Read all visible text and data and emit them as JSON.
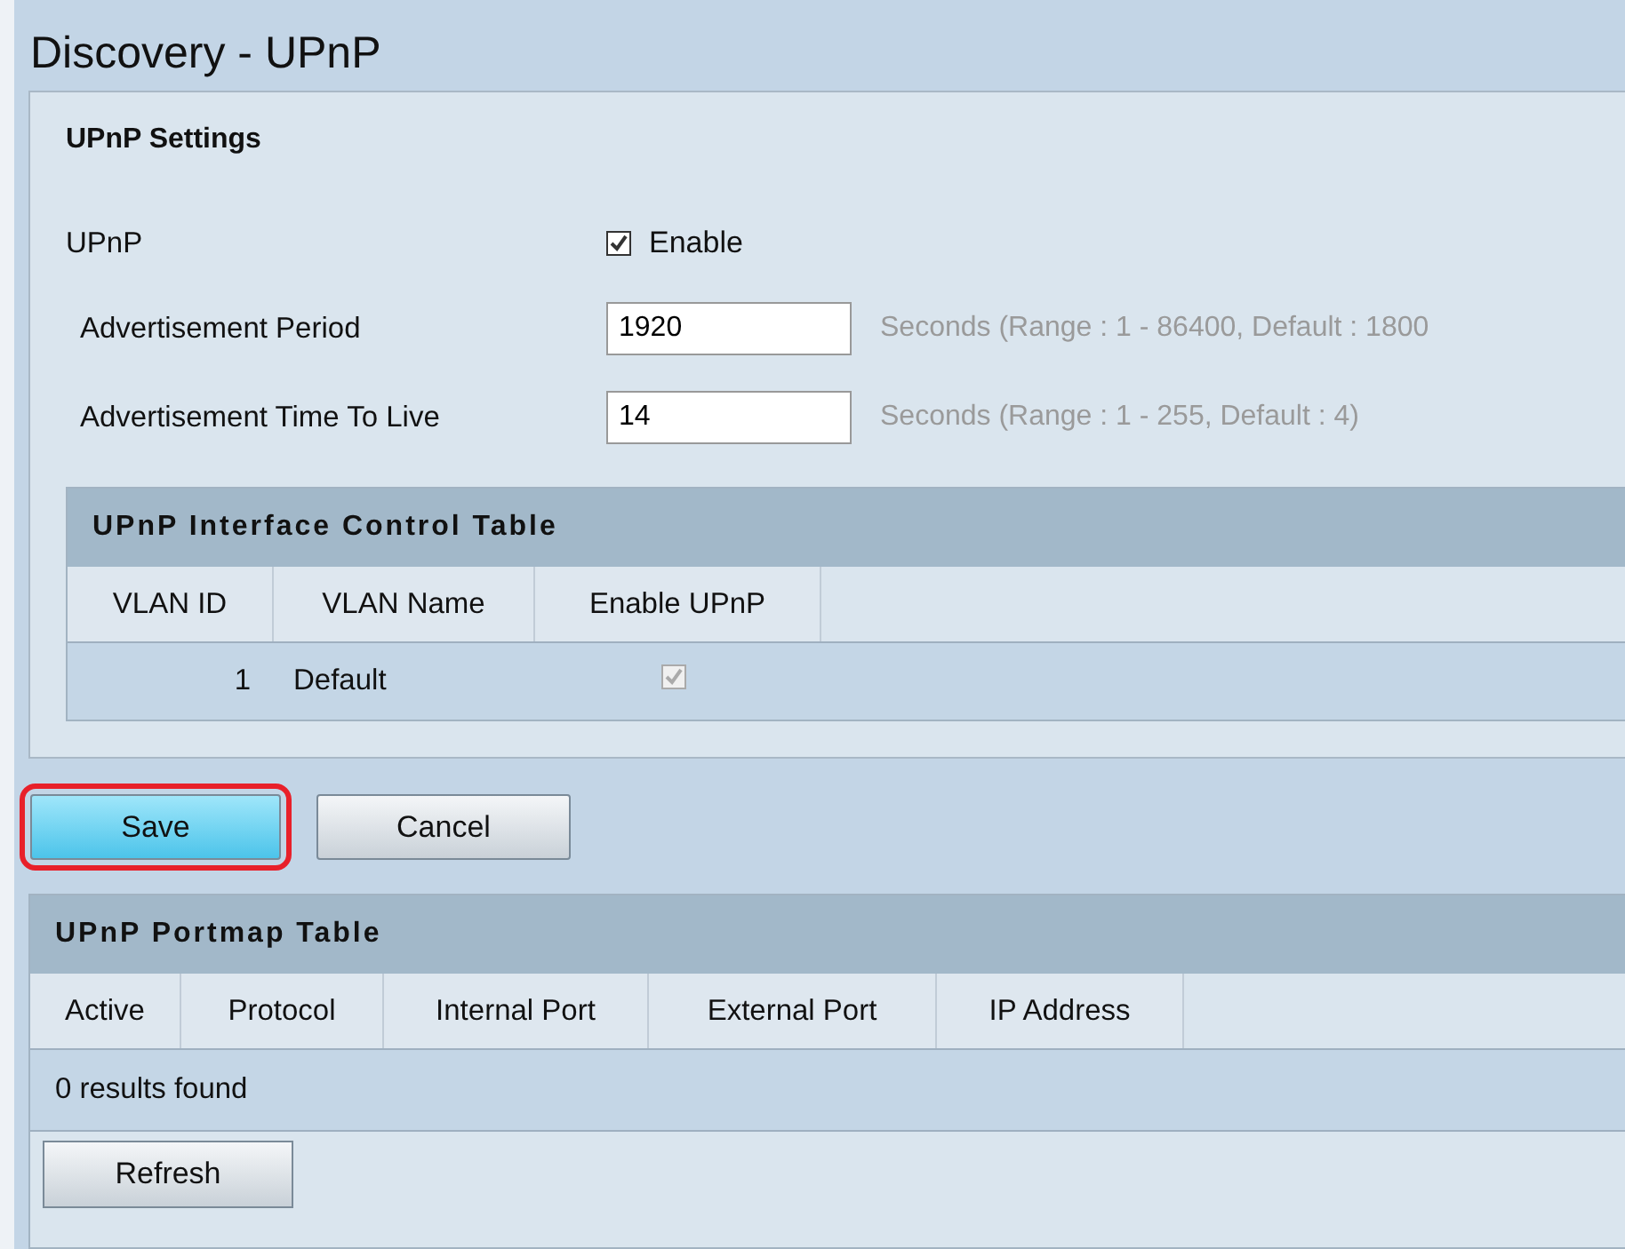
{
  "page_title": "Discovery - UPnP",
  "settings": {
    "title": "UPnP Settings",
    "upnp": {
      "label": "UPnP",
      "checkbox_label": "Enable",
      "checked": true
    },
    "fields": [
      {
        "label": "Advertisement Period",
        "value": "1920",
        "hint": "Seconds (Range : 1 - 86400, Default : 1800"
      },
      {
        "label": "Advertisement Time To Live",
        "value": "14",
        "hint": "Seconds (Range : 1 - 255, Default : 4)"
      }
    ],
    "interface_table": {
      "title": "UPnP Interface Control Table",
      "columns": [
        "VLAN ID",
        "VLAN Name",
        "Enable UPnP"
      ],
      "rows": [
        {
          "vlan_id": "1",
          "vlan_name": "Default",
          "enabled": true,
          "disabled": true
        }
      ]
    }
  },
  "buttons": [
    {
      "label": "Save",
      "highlighted": true,
      "kind": "primary"
    },
    {
      "label": "Cancel",
      "highlighted": false,
      "kind": "secondary"
    }
  ],
  "portmap_table": {
    "title": "UPnP Portmap Table",
    "columns": [
      "Active",
      "Protocol",
      "Internal Port",
      "External Port",
      "IP Address"
    ],
    "status": "0 results found",
    "refresh_button": "Refresh"
  }
}
